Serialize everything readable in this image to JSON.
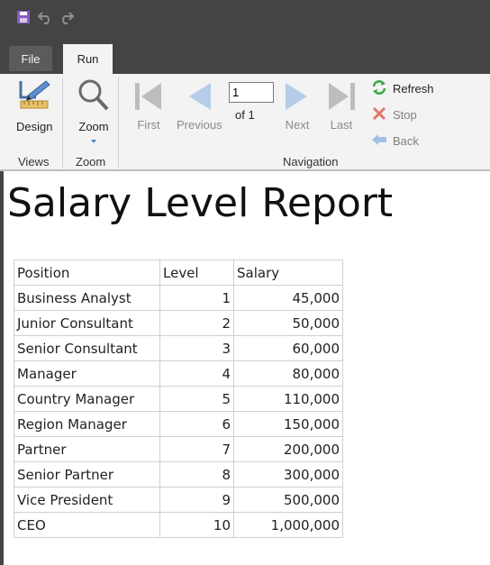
{
  "quick_access": {
    "icons": [
      "save-icon",
      "undo-icon",
      "redo-icon"
    ]
  },
  "tabs": [
    {
      "label": "File"
    },
    {
      "label": "Run"
    }
  ],
  "ribbon": {
    "groups": {
      "views": "Views",
      "zoom": "Zoom",
      "navigation": "Navigation"
    },
    "design_label": "Design",
    "zoom_label": "Zoom",
    "first_label": "First",
    "previous_label": "Previous",
    "page_value": "1",
    "of_label": "of  1",
    "next_label": "Next",
    "last_label": "Last",
    "refresh_label": "Refresh",
    "stop_label": "Stop",
    "back_label": "Back"
  },
  "report": {
    "title": "Salary Level Report",
    "columns": [
      "Position",
      "Level",
      "Salary"
    ],
    "rows": [
      {
        "position": "Business Analyst",
        "level": "1",
        "salary": "45,000"
      },
      {
        "position": "Junior Consultant",
        "level": "2",
        "salary": "50,000"
      },
      {
        "position": "Senior Consultant",
        "level": "3",
        "salary": "60,000"
      },
      {
        "position": "Manager",
        "level": "4",
        "salary": "80,000"
      },
      {
        "position": "Country Manager",
        "level": "5",
        "salary": "110,000"
      },
      {
        "position": "Region Manager",
        "level": "6",
        "salary": "150,000"
      },
      {
        "position": "Partner",
        "level": "7",
        "salary": "200,000"
      },
      {
        "position": "Senior Partner",
        "level": "8",
        "salary": "300,000"
      },
      {
        "position": "Vice President",
        "level": "9",
        "salary": "500,000"
      },
      {
        "position": "CEO",
        "level": "10",
        "salary": "1,000,000"
      }
    ]
  },
  "colors": {
    "chrome": "#444444",
    "ribbon": "#f3f3f3",
    "accent_blue": "#5b9bd5",
    "save_purple": "#7b4fa0"
  }
}
